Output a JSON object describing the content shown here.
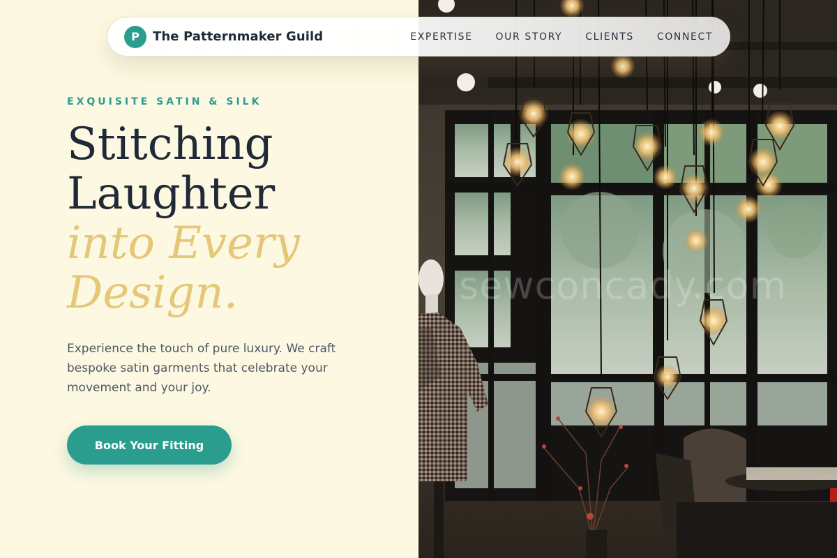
{
  "nav": {
    "logo_letter": "P",
    "brand_name": "The Patternmaker Guild",
    "links": [
      "EXPERTISE",
      "OUR STORY",
      "CLIENTS",
      "CONNECT"
    ]
  },
  "hero": {
    "eyebrow": "EXQUISITE SATIN & SILK",
    "headline_line1": "Stitching",
    "headline_line2": "Laughter",
    "headline_line3": "into Every",
    "headline_line4": "Design.",
    "lead": "Experience the touch of pure luxury. We craft bespoke satin garments that celebrate your movement and your joy.",
    "cta_label": "Book Your Fitting"
  },
  "photo": {
    "watermark": "sewconcady.com"
  },
  "colors": {
    "background": "#fdf8e1",
    "accent_teal": "#2a9d8f",
    "accent_gold": "#e5c877",
    "text_dark": "#1f2a36",
    "text_body": "#4e5864"
  }
}
